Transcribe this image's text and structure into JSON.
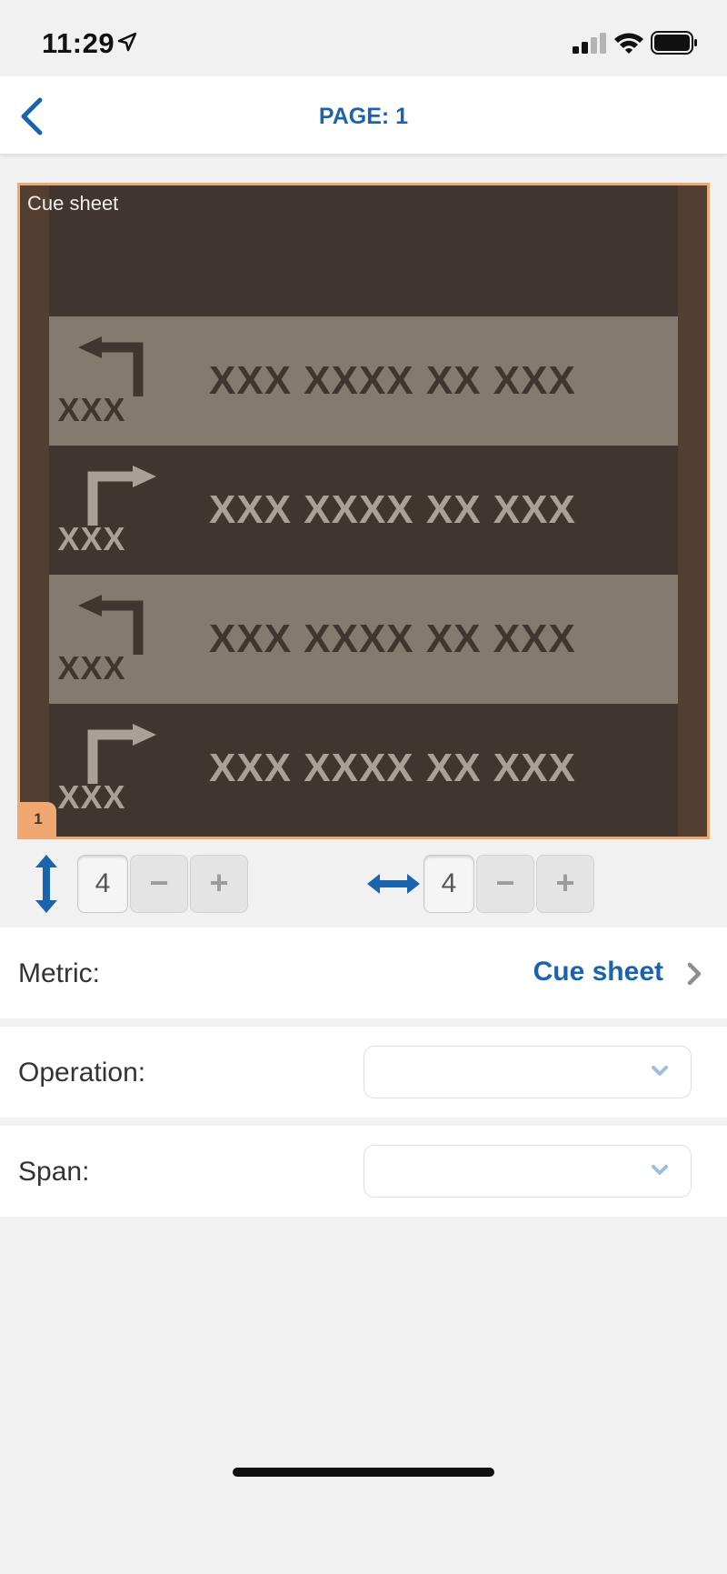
{
  "status_bar": {
    "time": "11:29",
    "icons": [
      "location-arrow-icon",
      "cellular-signal-icon",
      "wifi-icon",
      "battery-icon"
    ]
  },
  "nav": {
    "back_icon": "chevron-left-icon",
    "title": "PAGE: 1"
  },
  "preview": {
    "title": "Cue sheet",
    "page_number": "1",
    "rows": [
      {
        "direction": "left",
        "distance": "XXX",
        "text": "XXX XXXX XX XXX"
      },
      {
        "direction": "right",
        "distance": "XXX",
        "text": "XXX XXXX XX XXX"
      },
      {
        "direction": "left",
        "distance": "XXX",
        "text": "XXX XXXX XX XXX"
      },
      {
        "direction": "right",
        "distance": "XXX",
        "text": "XXX XXXX XX XXX"
      }
    ]
  },
  "steppers": {
    "vertical": {
      "icon": "vertical-resize-icon",
      "value": "4",
      "minus": "−",
      "plus": "+"
    },
    "horizontal": {
      "icon": "horizontal-resize-icon",
      "value": "4",
      "minus": "−",
      "plus": "+"
    }
  },
  "form": {
    "metric_label": "Metric:",
    "metric_value": "Cue sheet",
    "operation_label": "Operation:",
    "operation_value": "",
    "span_label": "Span:",
    "span_value": ""
  },
  "colors": {
    "accent": "#1c63ae",
    "preview_border": "#f0a870",
    "row_dark": "#41352f",
    "row_light": "#857a70"
  }
}
